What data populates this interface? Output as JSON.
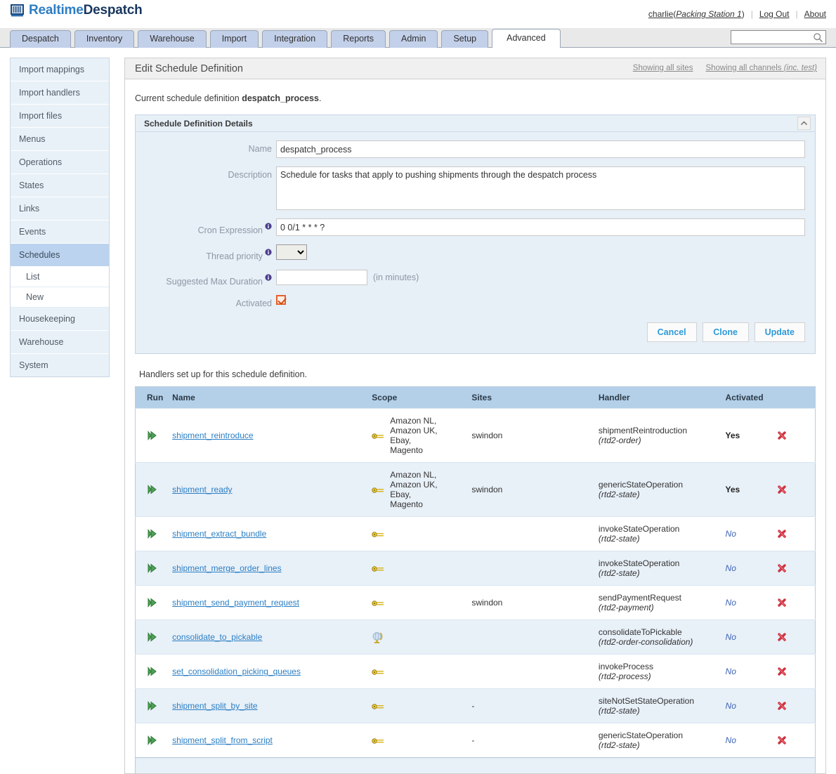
{
  "brand": {
    "name_light": "Realtime",
    "name_dark": "Despatch",
    "logo_icon": "barcode-icon"
  },
  "userbar": {
    "user": "charlie",
    "station_open": "(",
    "station": "Packing Station 1",
    "station_close": ")",
    "logout": "Log Out",
    "about": "About"
  },
  "search": {
    "value": "",
    "placeholder": "",
    "icon": "search-icon"
  },
  "tabs": [
    {
      "label": "Despatch",
      "active": false
    },
    {
      "label": "Inventory",
      "active": false
    },
    {
      "label": "Warehouse",
      "active": false
    },
    {
      "label": "Import",
      "active": false
    },
    {
      "label": "Integration",
      "active": false
    },
    {
      "label": "Reports",
      "active": false
    },
    {
      "label": "Admin",
      "active": false
    },
    {
      "label": "Setup",
      "active": false
    },
    {
      "label": "Advanced",
      "active": true
    }
  ],
  "sidebar": {
    "items": [
      {
        "label": "Import mappings",
        "type": "item",
        "selected": false
      },
      {
        "label": "Import handlers",
        "type": "item",
        "selected": false
      },
      {
        "label": "Import files",
        "type": "item",
        "selected": false
      },
      {
        "label": "Menus",
        "type": "item",
        "selected": false
      },
      {
        "label": "Operations",
        "type": "item",
        "selected": false
      },
      {
        "label": "States",
        "type": "item",
        "selected": false
      },
      {
        "label": "Links",
        "type": "item",
        "selected": false
      },
      {
        "label": "Events",
        "type": "item",
        "selected": false
      },
      {
        "label": "Schedules",
        "type": "item",
        "selected": true
      },
      {
        "label": "List",
        "type": "sub",
        "selected": false
      },
      {
        "label": "New",
        "type": "sub",
        "selected": false
      },
      {
        "label": "Housekeeping",
        "type": "item",
        "selected": false
      },
      {
        "label": "Warehouse",
        "type": "item",
        "selected": false
      },
      {
        "label": "System",
        "type": "item",
        "selected": false
      }
    ]
  },
  "content": {
    "title": "Edit Schedule Definition",
    "showing_sites": "Showing all sites",
    "showing_channels": "Showing all channels",
    "showing_channels_inc": "(inc. test)",
    "current_prefix": "Current schedule definition ",
    "current_name": "despatch_process",
    "current_suffix": "."
  },
  "panel": {
    "title": "Schedule Definition Details",
    "collapse_icon": "chevron-up-icon",
    "fields": {
      "name_label": "Name",
      "name_value": "despatch_process",
      "description_label": "Description",
      "description_value": "Schedule for tasks that apply to pushing shipments through the despatch process",
      "cron_label": "Cron Expression",
      "cron_value": "0 0/1 * * * ?",
      "thread_label": "Thread priority",
      "thread_value": "",
      "duration_label": "Suggested Max Duration",
      "duration_value": "",
      "duration_suffix": "(in minutes)",
      "activated_label": "Activated",
      "activated_checked": true
    },
    "buttons": {
      "cancel": "Cancel",
      "clone": "Clone",
      "update": "Update"
    }
  },
  "handlers": {
    "note": "Handlers set up for this schedule definition.",
    "columns": [
      "Run",
      "Name",
      "Scope",
      "Sites",
      "Handler",
      "Activated",
      ""
    ],
    "rows": [
      {
        "run_icon": "play-icon",
        "name": "shipment_reintroduce",
        "scope_icon": "key-icon",
        "scope_text": "Amazon NL, Amazon UK, Ebay, Magento",
        "sites": "swindon",
        "handler": "shipmentReintroduction",
        "handler_sub": "(rtd2-order)",
        "activated": "Yes",
        "activated_style": "yes",
        "delete_icon": "delete-x-icon"
      },
      {
        "run_icon": "play-icon",
        "name": "shipment_ready",
        "scope_icon": "key-icon",
        "scope_text": "Amazon NL, Amazon UK, Ebay, Magento",
        "sites": "swindon",
        "handler": "genericStateOperation",
        "handler_sub": "(rtd2-state)",
        "activated": "Yes",
        "activated_style": "yes",
        "delete_icon": "delete-x-icon"
      },
      {
        "run_icon": "play-icon",
        "name": "shipment_extract_bundle",
        "scope_icon": "key-icon",
        "scope_text": "",
        "sites": "",
        "handler": "invokeStateOperation",
        "handler_sub": "(rtd2-state)",
        "activated": "No",
        "activated_style": "no",
        "delete_icon": "delete-x-icon"
      },
      {
        "run_icon": "play-icon",
        "name": "shipment_merge_order_lines",
        "scope_icon": "key-icon",
        "scope_text": "",
        "sites": "",
        "handler": "invokeStateOperation",
        "handler_sub": "(rtd2-state)",
        "activated": "No",
        "activated_style": "no",
        "delete_icon": "delete-x-icon"
      },
      {
        "run_icon": "play-icon",
        "name": "shipment_send_payment_request",
        "scope_icon": "key-icon",
        "scope_text": "",
        "sites": "swindon",
        "handler": "sendPaymentRequest",
        "handler_sub": "(rtd2-payment)",
        "activated": "No",
        "activated_style": "no",
        "delete_icon": "delete-x-icon"
      },
      {
        "run_icon": "play-icon",
        "name": "consolidate_to_pickable",
        "scope_icon": "globe-icon",
        "scope_text": "",
        "sites": "",
        "handler": "consolidateToPickable",
        "handler_sub": "(rtd2-order-consolidation)",
        "activated": "No",
        "activated_style": "no",
        "delete_icon": "delete-x-icon"
      },
      {
        "run_icon": "play-icon",
        "name": "set_consolidation_picking_queues",
        "scope_icon": "key-icon",
        "scope_text": "",
        "sites": "",
        "handler": "invokeProcess",
        "handler_sub": "(rtd2-process)",
        "activated": "No",
        "activated_style": "no",
        "delete_icon": "delete-x-icon"
      },
      {
        "run_icon": "play-icon",
        "name": "shipment_split_by_site",
        "scope_icon": "key-icon",
        "scope_text": "",
        "sites": "-",
        "handler": "siteNotSetStateOperation",
        "handler_sub": "(rtd2-state)",
        "activated": "No",
        "activated_style": "no",
        "delete_icon": "delete-x-icon"
      },
      {
        "run_icon": "play-icon",
        "name": "shipment_split_from_script",
        "scope_icon": "key-icon",
        "scope_text": "",
        "sites": "-",
        "handler": "genericStateOperation",
        "handler_sub": "(rtd2-state)",
        "activated": "No",
        "activated_style": "no",
        "delete_icon": "delete-x-icon"
      }
    ]
  }
}
